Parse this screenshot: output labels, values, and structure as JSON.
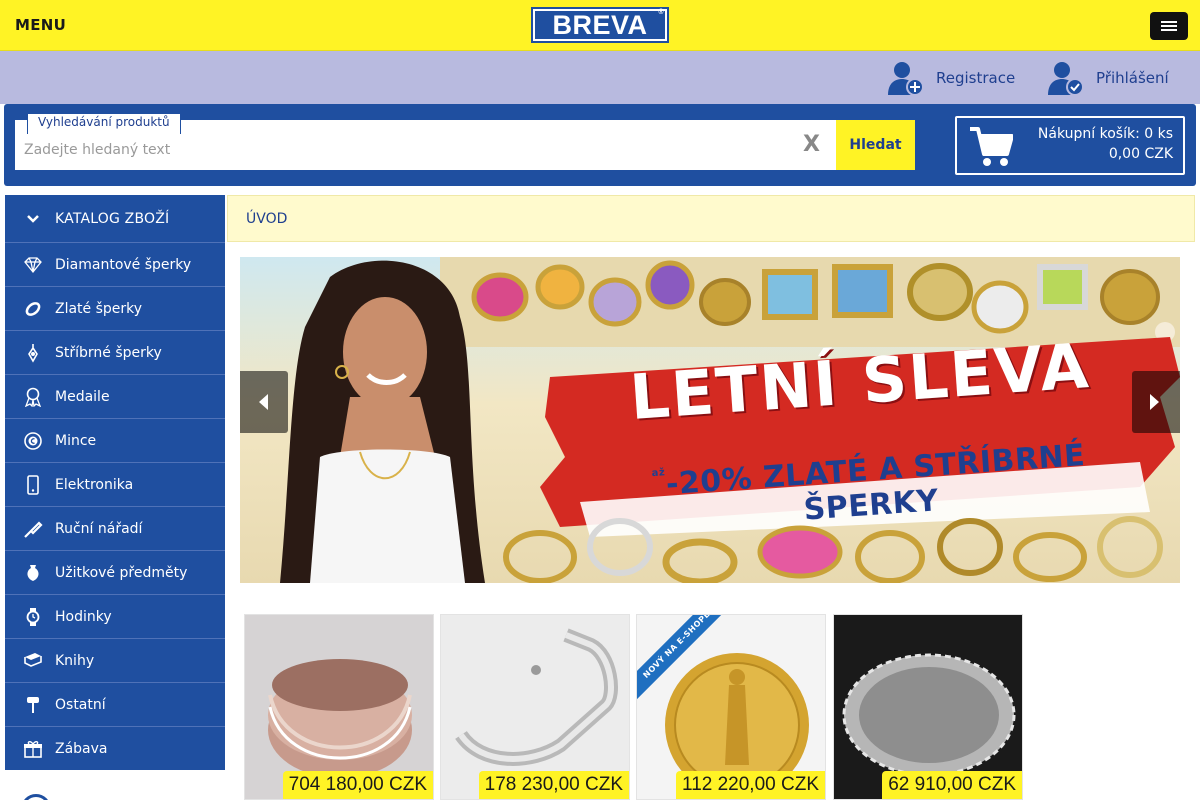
{
  "topbar": {
    "menu_label": "MENU",
    "logo_text": "BREVA",
    "logo_reg": "®"
  },
  "userbar": {
    "register_label": "Registrace",
    "login_label": "Přihlášení"
  },
  "search": {
    "legend": "Vyhledávání produktů",
    "placeholder": "Zadejte hledaný text",
    "value": "",
    "clear_glyph": "X",
    "button_label": "Hledat"
  },
  "cart": {
    "line1": "Nákupní košík: 0 ks",
    "line2": "0,00 CZK"
  },
  "sidebar": {
    "header": "KATALOG ZBOŽÍ",
    "items": [
      {
        "label": "Diamantové šperky",
        "icon": "diamond-icon"
      },
      {
        "label": "Zlaté šperky",
        "icon": "ring-icon"
      },
      {
        "label": "Stříbrné šperky",
        "icon": "pendant-icon"
      },
      {
        "label": "Medaile",
        "icon": "medal-icon"
      },
      {
        "label": "Mince",
        "icon": "coin-icon"
      },
      {
        "label": "Elektronika",
        "icon": "phone-icon"
      },
      {
        "label": "Ruční nářadí",
        "icon": "tool-icon"
      },
      {
        "label": "Užitkové předměty",
        "icon": "vase-icon"
      },
      {
        "label": "Hodinky",
        "icon": "watch-icon"
      },
      {
        "label": "Knihy",
        "icon": "book-icon"
      },
      {
        "label": "Ostatní",
        "icon": "misc-icon"
      },
      {
        "label": "Zábava",
        "icon": "gift-icon"
      }
    ]
  },
  "breadcrumb": {
    "label": "ÚVOD"
  },
  "banner": {
    "title": "LETNÍ SLEVA",
    "sub_prefix": "až",
    "subtitle": "-20% ZLATÉ A STŘÍBRNÉ ŠPERKY"
  },
  "products": [
    {
      "price": "704 180,00 CZK",
      "image": "rose-gold bangle bracelet",
      "badge": ""
    },
    {
      "price": "178 230,00 CZK",
      "image": "silver link bracelet",
      "badge": ""
    },
    {
      "price": "112 220,00 CZK",
      "image": "gold coin",
      "badge": "NOVÝ NA E-SHOPE"
    },
    {
      "price": "62 910,00 CZK",
      "image": "silver oval tray",
      "badge": ""
    }
  ],
  "colors": {
    "brand_blue": "#1f4fa0",
    "brand_yellow": "#fff325",
    "userbar_bg": "#b8badf",
    "breadcrumb_bg": "#fffacd"
  }
}
